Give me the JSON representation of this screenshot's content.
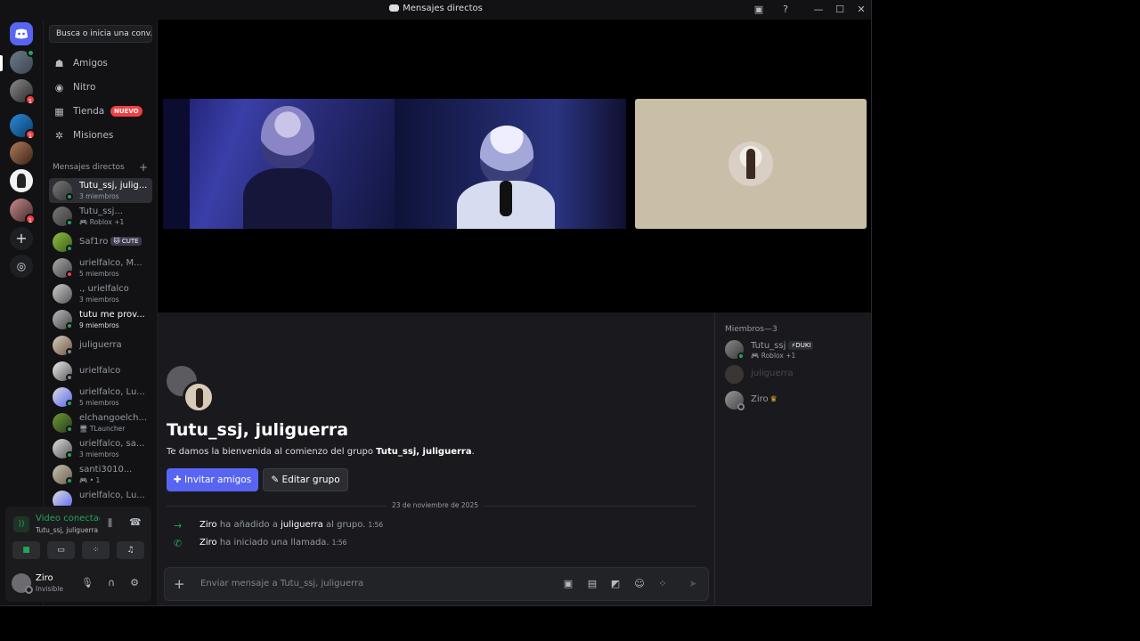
{
  "window": {
    "title": "Mensajes directos"
  },
  "search": {
    "placeholder": "Busca o inicia una conv..."
  },
  "nav": [
    {
      "label": "Amigos",
      "icon": "friends-icon"
    },
    {
      "label": "Nitro",
      "icon": "nitro-icon"
    },
    {
      "label": "Tienda",
      "icon": "shop-icon",
      "badge": "NUEVO"
    },
    {
      "label": "Misiones",
      "icon": "quests-icon"
    }
  ],
  "dm_header": "Mensajes directos",
  "server_badges": [
    "1",
    "1",
    "1"
  ],
  "dms": [
    {
      "name": "Tutu_ssj, julig...",
      "sub": "3 miembros"
    },
    {
      "name": "Tutu_ssj...",
      "sub": "🎮 Roblox +1"
    },
    {
      "name": "Saf1ro",
      "tag": "🐱 CUTE"
    },
    {
      "name": "urielfalco, M...",
      "sub": "5 miembros"
    },
    {
      "name": "., urielfalco",
      "sub": "3 miembros"
    },
    {
      "name": "tutu me prov...",
      "sub": "9 miembros"
    },
    {
      "name": "juliguerra"
    },
    {
      "name": "urielfalco"
    },
    {
      "name": "urielfalco, Lu...",
      "sub": "5 miembros"
    },
    {
      "name": "elchangoelch...",
      "sub": "🖥 TLauncher"
    },
    {
      "name": "urielfalco, sa...",
      "sub": "3 miembros"
    },
    {
      "name": "santi3010...",
      "sub": "🎮 • 1"
    },
    {
      "name": "urielfalco, Lu..."
    }
  ],
  "voice": {
    "status": "Video conectado",
    "channel": "Tutu_ssj, juliguerra"
  },
  "user": {
    "name": "Ziro",
    "status": "Invisible"
  },
  "chat": {
    "title": "Tutu_ssj, juliguerra",
    "welcome_prefix": "Te damos la bienvenida al comienzo del grupo ",
    "welcome_name": "Tutu_ssj, juliguerra",
    "welcome_suffix": ".",
    "invite_label": "Invitar amigos",
    "edit_label": "Editar grupo",
    "date_divider": "23 de noviembre de 2025",
    "messages": [
      {
        "actor": "Ziro",
        "text1": " ha añadido a ",
        "target": "juliguerra",
        "text2": " al grupo.",
        "time": "1:56"
      },
      {
        "actor": "Ziro",
        "text1": " ha iniciado una llamada.",
        "target": "",
        "text2": "",
        "time": "1:56"
      }
    ],
    "composer_placeholder": "Enviar mensaje a Tutu_ssj, juliguerra"
  },
  "members": {
    "header": "Miembros—3",
    "list": [
      {
        "name": "Tutu_ssj",
        "tag": "⚡DUKI",
        "sub": "🎮 Roblox +1"
      },
      {
        "name": "juliguerra"
      },
      {
        "name": "Ziro"
      }
    ]
  },
  "colors": {
    "accent": "#5865f2",
    "online": "#23a55a",
    "badge": "#f23f43",
    "background": "#121214"
  }
}
